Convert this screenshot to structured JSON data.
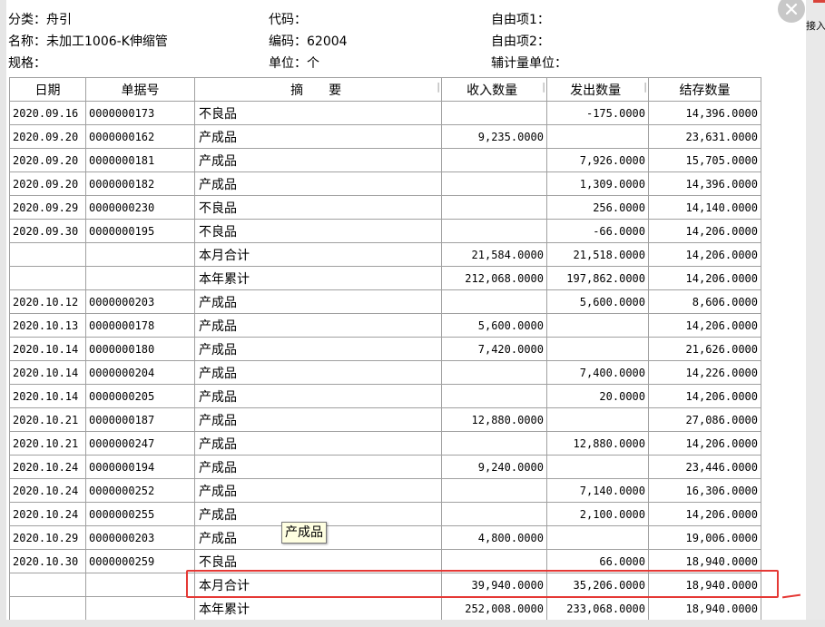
{
  "header": {
    "category": "分类：舟引",
    "code": "代码：",
    "custom1": "自由项1：",
    "name": "名称：未加工1006-K伸缩管",
    "bianma": "编码：62004",
    "custom2": "自由项2：",
    "spec": "规格：",
    "unit": "单位：个",
    "aux_unit": "辅计量单位："
  },
  "right_tab": "接入",
  "columns": {
    "date": "日期",
    "doc_no": "单据号",
    "memo": "摘　　要",
    "in_qty": "收入数量",
    "out_qty": "发出数量",
    "balance": "结存数量"
  },
  "rows": [
    {
      "date": "2020.09.16",
      "doc": "0000000173",
      "memo": "不良品",
      "in": "",
      "out": "-175.0000",
      "bal": "14,396.0000"
    },
    {
      "date": "2020.09.20",
      "doc": "0000000162",
      "memo": "产成品",
      "in": "9,235.0000",
      "out": "",
      "bal": "23,631.0000"
    },
    {
      "date": "2020.09.20",
      "doc": "0000000181",
      "memo": "产成品",
      "in": "",
      "out": "7,926.0000",
      "bal": "15,705.0000"
    },
    {
      "date": "2020.09.20",
      "doc": "0000000182",
      "memo": "产成品",
      "in": "",
      "out": "1,309.0000",
      "bal": "14,396.0000"
    },
    {
      "date": "2020.09.29",
      "doc": "0000000230",
      "memo": "不良品",
      "in": "",
      "out": "256.0000",
      "bal": "14,140.0000"
    },
    {
      "date": "2020.09.30",
      "doc": "0000000195",
      "memo": "不良品",
      "in": "",
      "out": "-66.0000",
      "bal": "14,206.0000"
    },
    {
      "date": "",
      "doc": "",
      "memo": "本月合计",
      "in": "21,584.0000",
      "out": "21,518.0000",
      "bal": "14,206.0000"
    },
    {
      "date": "",
      "doc": "",
      "memo": "本年累计",
      "in": "212,068.0000",
      "out": "197,862.0000",
      "bal": "14,206.0000"
    },
    {
      "date": "2020.10.12",
      "doc": "0000000203",
      "memo": "产成品",
      "in": "",
      "out": "5,600.0000",
      "bal": "8,606.0000"
    },
    {
      "date": "2020.10.13",
      "doc": "0000000178",
      "memo": "产成品",
      "in": "5,600.0000",
      "out": "",
      "bal": "14,206.0000"
    },
    {
      "date": "2020.10.14",
      "doc": "0000000180",
      "memo": "产成品",
      "in": "7,420.0000",
      "out": "",
      "bal": "21,626.0000"
    },
    {
      "date": "2020.10.14",
      "doc": "0000000204",
      "memo": "产成品",
      "in": "",
      "out": "7,400.0000",
      "bal": "14,226.0000"
    },
    {
      "date": "2020.10.14",
      "doc": "0000000205",
      "memo": "产成品",
      "in": "",
      "out": "20.0000",
      "bal": "14,206.0000"
    },
    {
      "date": "2020.10.21",
      "doc": "0000000187",
      "memo": "产成品",
      "in": "12,880.0000",
      "out": "",
      "bal": "27,086.0000"
    },
    {
      "date": "2020.10.21",
      "doc": "0000000247",
      "memo": "产成品",
      "in": "",
      "out": "12,880.0000",
      "bal": "14,206.0000"
    },
    {
      "date": "2020.10.24",
      "doc": "0000000194",
      "memo": "产成品",
      "in": "9,240.0000",
      "out": "",
      "bal": "23,446.0000"
    },
    {
      "date": "2020.10.24",
      "doc": "0000000252",
      "memo": "产成品",
      "in": "",
      "out": "7,140.0000",
      "bal": "16,306.0000"
    },
    {
      "date": "2020.10.24",
      "doc": "0000000255",
      "memo": "产成品",
      "in": "",
      "out": "2,100.0000",
      "bal": "14,206.0000"
    },
    {
      "date": "2020.10.29",
      "doc": "0000000203",
      "memo": "产成品",
      "in": "4,800.0000",
      "out": "",
      "bal": "19,006.0000"
    },
    {
      "date": "2020.10.30",
      "doc": "0000000259",
      "memo": "不良品",
      "in": "",
      "out": "66.0000",
      "bal": "18,940.0000"
    },
    {
      "date": "",
      "doc": "",
      "memo": "本月合计",
      "in": "39,940.0000",
      "out": "35,206.0000",
      "bal": "18,940.0000"
    },
    {
      "date": "",
      "doc": "",
      "memo": "本年累计",
      "in": "252,008.0000",
      "out": "233,068.0000",
      "bal": "18,940.0000"
    }
  ],
  "tooltip": "产成品"
}
